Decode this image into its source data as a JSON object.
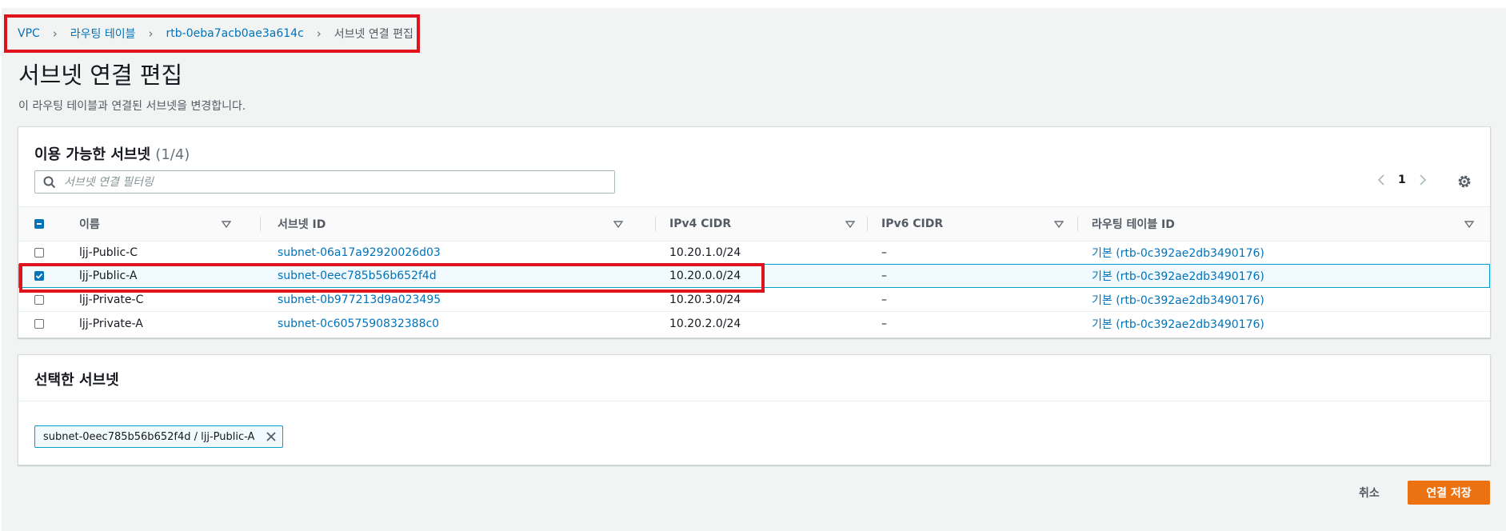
{
  "breadcrumb": {
    "items": [
      "VPC",
      "라우팅 테이블",
      "rtb-0eba7acb0ae3a614c"
    ],
    "current": "서브넷 연결 편집"
  },
  "page": {
    "title": "서브넷 연결 편집",
    "description": "이 라우팅 테이블과 연결된 서브넷을 변경합니다."
  },
  "available": {
    "title": "이용 가능한 서브넷",
    "count": "(1/4)",
    "filter_placeholder": "서브넷 연결 필터링",
    "page_number": "1",
    "columns": [
      "이름",
      "서브넷 ID",
      "IPv4 CIDR",
      "IPv6 CIDR",
      "라우팅 테이블 ID"
    ],
    "rows": [
      {
        "checked": false,
        "name": "ljj-Public-C",
        "subnet_id": "subnet-06a17a92920026d03",
        "ipv4": "10.20.1.0/24",
        "ipv6": "–",
        "route_table": "기본 (rtb-0c392ae2db3490176)"
      },
      {
        "checked": true,
        "name": "ljj-Public-A",
        "subnet_id": "subnet-0eec785b56b652f4d",
        "ipv4": "10.20.0.0/24",
        "ipv6": "–",
        "route_table": "기본 (rtb-0c392ae2db3490176)"
      },
      {
        "checked": false,
        "name": "ljj-Private-C",
        "subnet_id": "subnet-0b977213d9a023495",
        "ipv4": "10.20.3.0/24",
        "ipv6": "–",
        "route_table": "기본 (rtb-0c392ae2db3490176)"
      },
      {
        "checked": false,
        "name": "ljj-Private-A",
        "subnet_id": "subnet-0c6057590832388c0",
        "ipv4": "10.20.2.0/24",
        "ipv6": "–",
        "route_table": "기본 (rtb-0c392ae2db3490176)"
      }
    ]
  },
  "selected": {
    "title": "선택한 서브넷",
    "token_label": "subnet-0eec785b56b652f4d / ljj-Public-A"
  },
  "footer": {
    "cancel_label": "취소",
    "save_label": "연결 저장"
  },
  "colors": {
    "link": "#0073bb",
    "primary_button": "#ec7211",
    "highlight_box": "#e0121c",
    "selection": "#00a1c9"
  }
}
